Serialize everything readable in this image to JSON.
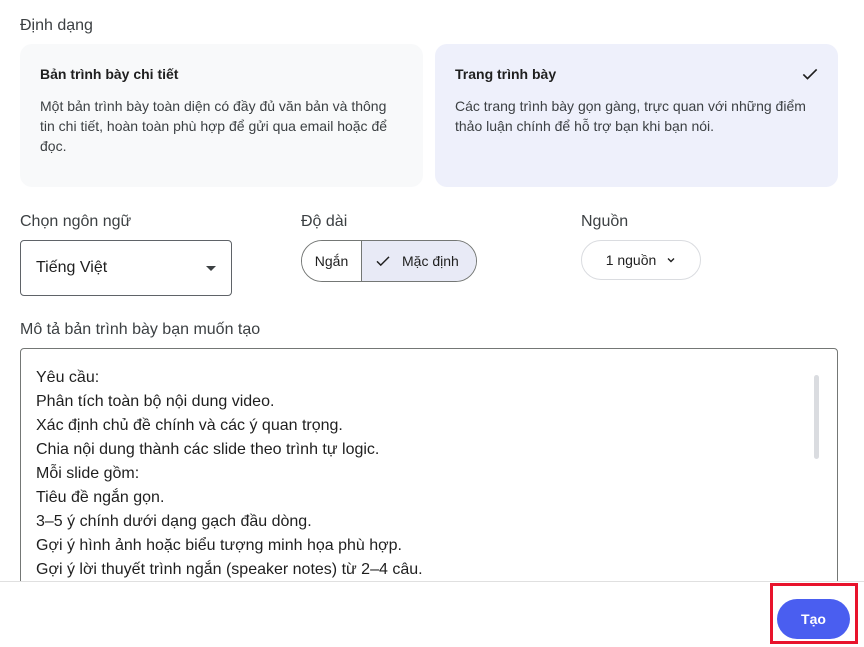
{
  "format": {
    "label": "Định dạng",
    "cards": [
      {
        "title": "Bản trình bày chi tiết",
        "description": "Một bản trình bày toàn diện có đầy đủ văn bản và thông tin chi tiết, hoàn toàn phù hợp để gửi qua email hoặc để đọc.",
        "selected": false
      },
      {
        "title": "Trang trình bày",
        "description": "Các trang trình bày gọn gàng, trực quan với những điểm thảo luận chính để hỗ trợ bạn khi bạn nói.",
        "selected": true
      }
    ]
  },
  "language": {
    "label": "Chọn ngôn ngữ",
    "value": "Tiếng Việt"
  },
  "length": {
    "label": "Độ dài",
    "options": [
      "Ngắn",
      "Mặc định"
    ],
    "selected": "Mặc định"
  },
  "sources": {
    "label": "Nguồn",
    "value": "1 nguồn"
  },
  "prompt": {
    "label": "Mô tả bản trình bày bạn muốn tạo",
    "lines": [
      "Yêu cầu:",
      "Phân tích toàn bộ nội dung video.",
      "Xác định chủ đề chính và các ý quan trọng.",
      "Chia nội dung thành các slide theo trình tự logic.",
      "Mỗi slide gồm:",
      "Tiêu đề ngắn gọn.",
      "3–5 ý chính dưới dạng gạch đầu dòng.",
      "Gợi ý hình ảnh hoặc biểu tượng minh họa phù hợp.",
      "Gợi ý lời thuyết trình ngắn (speaker notes) từ 2–4 câu."
    ]
  },
  "actions": {
    "create_label": "Tạo"
  },
  "colors": {
    "primary": "#4a5ef0",
    "selected_card": "#eef0fb",
    "highlight": "#e8132c"
  },
  "icons": {
    "selected": "check-icon",
    "dropdown": "caret-down-icon",
    "chevron": "chevron-down-icon"
  }
}
